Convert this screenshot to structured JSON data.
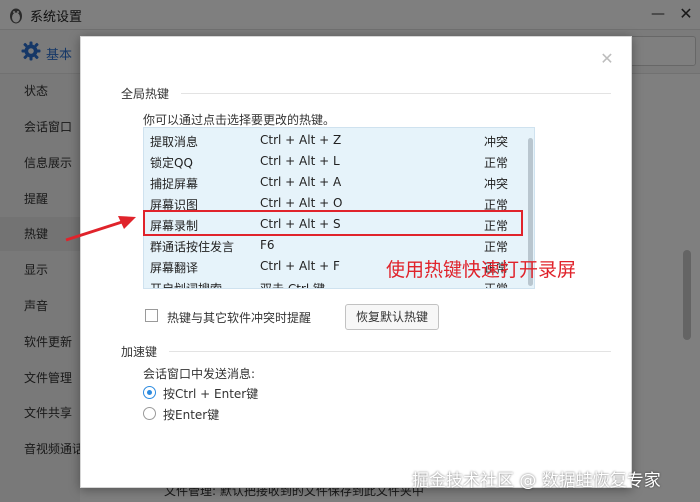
{
  "window": {
    "title": "系统设置",
    "minimize_glyph": "—",
    "close_glyph": "✕",
    "basic_tab_label": "基本",
    "footer_text": "文件管理: 默认把接收到的文件保存到此文件夹中"
  },
  "sidebar": {
    "items": [
      {
        "label": "状态"
      },
      {
        "label": "会话窗口"
      },
      {
        "label": "信息展示"
      },
      {
        "label": "提醒"
      },
      {
        "label": "热键"
      },
      {
        "label": "显示"
      },
      {
        "label": "声音"
      },
      {
        "label": "软件更新"
      },
      {
        "label": "文件管理"
      },
      {
        "label": "文件共享"
      },
      {
        "label": "音视频通话"
      }
    ]
  },
  "dialog": {
    "close_glyph": "✕",
    "global_hotkeys": {
      "title": "全局热键",
      "description": "你可以通过点击选择要更改的热键。",
      "rows": [
        {
          "name": "提取消息",
          "key": "Ctrl + Alt + Z",
          "status": "冲突"
        },
        {
          "name": "锁定QQ",
          "key": "Ctrl + Alt + L",
          "status": "正常"
        },
        {
          "name": "捕捉屏幕",
          "key": "Ctrl + Alt + A",
          "status": "冲突"
        },
        {
          "name": "屏幕识图",
          "key": "Ctrl + Alt + O",
          "status": "正常"
        },
        {
          "name": "屏幕录制",
          "key": "Ctrl + Alt + S",
          "status": "正常"
        },
        {
          "name": "群通话按住发言",
          "key": "F6",
          "status": "正常"
        },
        {
          "name": "屏幕翻译",
          "key": "Ctrl + Alt + F",
          "status": "正常"
        },
        {
          "name": "开启划词搜索",
          "key": "双击 Ctrl 键",
          "status": "正常"
        }
      ],
      "conflict_reminder_label": "热键与其它软件冲突时提醒",
      "restore_default_button": "恢复默认热键"
    },
    "accelerator": {
      "title": "加速键",
      "description": "会话窗口中发送消息:",
      "options": [
        {
          "label": "按Ctrl + Enter键",
          "checked": true
        },
        {
          "label": "按Enter键",
          "checked": false
        }
      ]
    }
  },
  "annotation": {
    "text": "使用热键快速打开录屏",
    "color": "#e0232b"
  },
  "watermark": "掘金技术社区 @ 数据蛙恢复专家",
  "colors": {
    "accent": "#2c8be0",
    "list_bg": "#e6f3fa",
    "highlight": "#e0232b"
  }
}
